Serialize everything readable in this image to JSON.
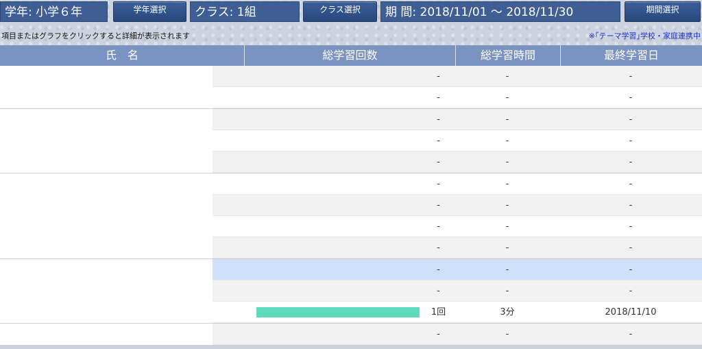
{
  "header": {
    "grade_label": "学年: 小学６年",
    "grade_button": "学年選択",
    "class_label": "クラス: 1組",
    "class_button": "クラス選択",
    "period_label": "期 間: 2018/11/01 ～ 2018/11/30",
    "period_button": "期間選択"
  },
  "instruction": "項目またはグラフをクリックすると詳細が表示されます",
  "notice": "※｢テーマ学習｣学校・家庭連携中",
  "table": {
    "columns": [
      "氏　名",
      "総学習回数",
      "総学習時間",
      "最終学習日"
    ],
    "rows": [
      {
        "count": "-",
        "time": "-",
        "last": "-",
        "bar": 0
      },
      {
        "count": "-",
        "time": "-",
        "last": "-",
        "bar": 0
      },
      {
        "count": "-",
        "time": "-",
        "last": "-",
        "bar": 0
      },
      {
        "count": "-",
        "time": "-",
        "last": "-",
        "bar": 0
      },
      {
        "count": "-",
        "time": "-",
        "last": "-",
        "bar": 0
      },
      {
        "count": "-",
        "time": "-",
        "last": "-",
        "bar": 0
      },
      {
        "count": "-",
        "time": "-",
        "last": "-",
        "bar": 0
      },
      {
        "count": "-",
        "time": "-",
        "last": "-",
        "bar": 0
      },
      {
        "count": "-",
        "time": "-",
        "last": "-",
        "bar": 0
      },
      {
        "count": "-",
        "time": "-",
        "last": "-",
        "bar": 0,
        "selected": true
      },
      {
        "count": "-",
        "time": "-",
        "last": "-",
        "bar": 0
      },
      {
        "count": "1回",
        "time": "3分",
        "last": "2018/11/10",
        "bar": 1
      },
      {
        "count": "-",
        "time": "-",
        "last": "-",
        "bar": 0
      }
    ]
  },
  "colors": {
    "header_bg": "#3f5f94",
    "table_header_bg": "#7b93c1",
    "bar_color": "#5dd9bc",
    "selected_row": "#cfe0fb",
    "notice_text": "#1a2fd0"
  }
}
